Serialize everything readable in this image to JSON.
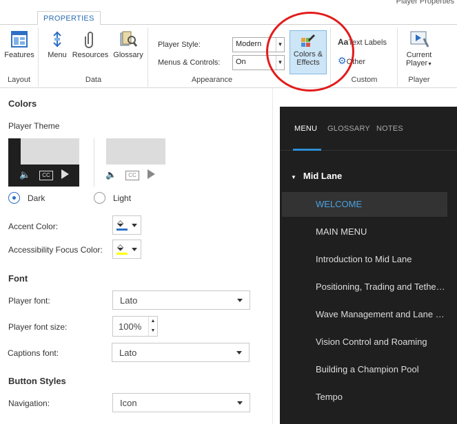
{
  "window": {
    "title": "Player Properties"
  },
  "ribbon": {
    "tab": "PROPERTIES",
    "groups": {
      "layout": {
        "label": "Layout",
        "features": "Features"
      },
      "data": {
        "label": "Data",
        "menu": "Menu",
        "resources": "Resources",
        "glossary": "Glossary"
      },
      "appearance": {
        "label": "Appearance",
        "player_style_label": "Player Style:",
        "player_style_value": "Modern",
        "menus_controls_label": "Menus & Controls:",
        "menus_controls_value": "On",
        "colors_line1": "Colors &",
        "colors_line2": "Effects"
      },
      "custom": {
        "label": "Custom",
        "text_labels": "Text Labels",
        "other": "Other"
      },
      "player": {
        "label": "Player",
        "current_line1": "Current",
        "current_line2": "Player"
      }
    }
  },
  "colors": {
    "heading": "Colors",
    "player_theme": "Player Theme",
    "dark": "Dark",
    "light": "Light",
    "selected_theme": "Dark",
    "accent_label": "Accent Color:",
    "accent_color": "#2d6fc4",
    "focus_label": "Accessibility Focus Color:",
    "focus_color": "#ffff00"
  },
  "font": {
    "heading": "Font",
    "player_font_label": "Player font:",
    "player_font": "Lato",
    "size_label": "Player font size:",
    "size": "100%",
    "captions_label": "Captions font:",
    "captions_font": "Lato"
  },
  "buttons": {
    "heading": "Button Styles",
    "navigation_label": "Navigation:",
    "navigation": "Icon"
  },
  "player": {
    "tabs": [
      "MENU",
      "GLOSSARY",
      "NOTES"
    ],
    "section": "Mid Lane",
    "items": [
      "WELCOME",
      "MAIN MENU",
      "Introduction to Mid Lane",
      "Positioning, Trading and Tethering",
      "Wave Management and Lane Control",
      "Vision Control and Roaming",
      "Building a Champion Pool",
      "Tempo"
    ],
    "accent": "#4aa3e0"
  }
}
